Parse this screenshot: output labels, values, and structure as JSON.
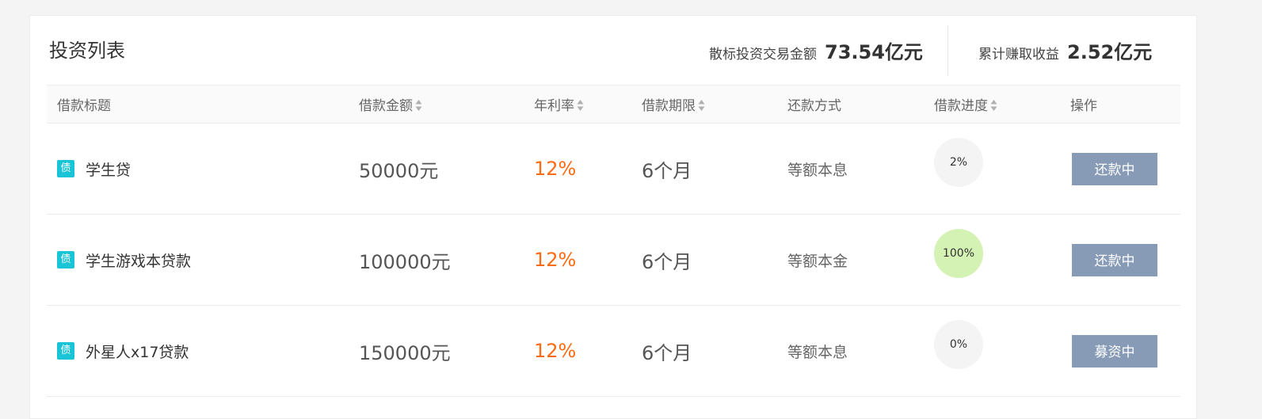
{
  "header": {
    "title": "投资列表",
    "stats": [
      {
        "label": "散标投资交易金额",
        "value": "73.54亿元"
      },
      {
        "label": "累计赚取收益",
        "value": "2.52亿元"
      }
    ]
  },
  "table": {
    "columns": [
      {
        "label": "借款标题",
        "sortable": false
      },
      {
        "label": "借款金额",
        "sortable": true
      },
      {
        "label": "年利率",
        "sortable": true
      },
      {
        "label": "借款期限",
        "sortable": true
      },
      {
        "label": "还款方式",
        "sortable": false
      },
      {
        "label": "借款进度",
        "sortable": true
      },
      {
        "label": "操作",
        "sortable": false
      }
    ],
    "badge_text": "债",
    "rows": [
      {
        "title": "学生贷",
        "amount": "50000元",
        "rate": "12%",
        "term": "6个月",
        "method": "等额本息",
        "progress": "2%",
        "progress_value": 2,
        "action": "还款中"
      },
      {
        "title": "学生游戏本贷款",
        "amount": "100000元",
        "rate": "12%",
        "term": "6个月",
        "method": "等额本金",
        "progress": "100%",
        "progress_value": 100,
        "action": "还款中"
      },
      {
        "title": "外星人x17贷款",
        "amount": "150000元",
        "rate": "12%",
        "term": "6个月",
        "method": "等额本息",
        "progress": "0%",
        "progress_value": 0,
        "action": "募资中"
      }
    ]
  },
  "colors": {
    "badge": "#19c4d6",
    "rate": "#ff6a13",
    "button": "#879bb6",
    "progress_incomplete": "#f4f4f4",
    "progress_complete": "#d3f2b4"
  }
}
